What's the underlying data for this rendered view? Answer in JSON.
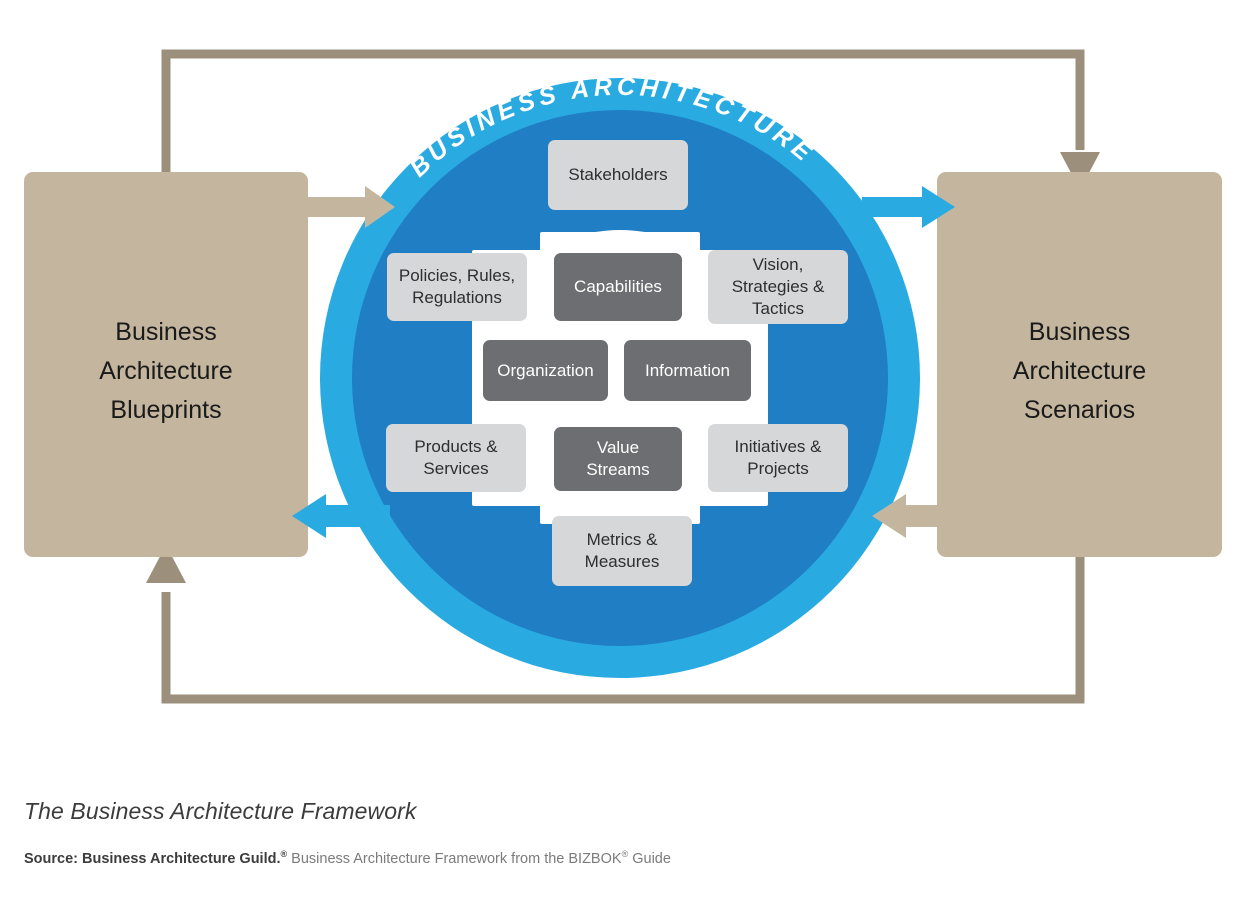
{
  "diagram": {
    "ring_label": "BUSINESS ARCHITECTURE",
    "left_panel": {
      "label": "Business\nArchitecture\nBlueprints"
    },
    "right_panel": {
      "label": "Business\nArchitecture\nScenarios"
    },
    "colors": {
      "ring_outer_blue": "#29abe2",
      "ring_inner_blue": "#1f7ec4",
      "inner_white": "#ffffff",
      "tile_light": "#d6d7d8",
      "tile_dark": "#6d6e71",
      "panel_tan": "#c4b69e",
      "connector_tan": "#9c8f7c",
      "arrow_tan": "#c4b69e",
      "arrow_blue": "#29abe2",
      "page_background": "#ffffff"
    },
    "tiles": [
      {
        "id": "stakeholders",
        "label": "Stakeholders",
        "style": "light"
      },
      {
        "id": "policies",
        "label": "Policies, Rules,\nRegulations",
        "style": "light"
      },
      {
        "id": "capabilities",
        "label": "Capabilities",
        "style": "dark"
      },
      {
        "id": "vision",
        "label": "Vision,\nStrategies &\nTactics",
        "style": "light"
      },
      {
        "id": "organization",
        "label": "Organization",
        "style": "dark"
      },
      {
        "id": "information",
        "label": "Information",
        "style": "dark"
      },
      {
        "id": "products-services",
        "label": "Products &\nServices",
        "style": "light"
      },
      {
        "id": "value-streams",
        "label": "Value\nStreams",
        "style": "dark"
      },
      {
        "id": "initiatives",
        "label": "Initiatives &\nProjects",
        "style": "light"
      },
      {
        "id": "metrics",
        "label": "Metrics &\nMeasures",
        "style": "light"
      }
    ],
    "flows": [
      {
        "id": "blueprints-to-circle",
        "from": "Business Architecture Blueprints",
        "to": "Business Architecture",
        "color": "#c4b69e",
        "direction": "right"
      },
      {
        "id": "circle-to-blueprints",
        "from": "Business Architecture",
        "to": "Business Architecture Blueprints",
        "color": "#29abe2",
        "direction": "left"
      },
      {
        "id": "circle-to-scenarios",
        "from": "Business Architecture",
        "to": "Business Architecture Scenarios",
        "color": "#29abe2",
        "direction": "right"
      },
      {
        "id": "scenarios-to-circle",
        "from": "Business Architecture Scenarios",
        "to": "Business Architecture",
        "color": "#c4b69e",
        "direction": "left"
      },
      {
        "id": "blueprints-to-scenarios-top",
        "from": "Business Architecture Blueprints",
        "to": "Business Architecture Scenarios",
        "color": "#9c8f7c",
        "direction": "down"
      },
      {
        "id": "scenarios-to-blueprints-bottom",
        "from": "Business Architecture Scenarios",
        "to": "Business Architecture Blueprints",
        "color": "#9c8f7c",
        "direction": "up"
      }
    ]
  },
  "caption": {
    "title": "The Business Architecture Framework",
    "source_bold": "Source: Business Architecture Guild.",
    "source_bold_sup": "®",
    "source_rest_a": " Business Architecture Framework from the BIZBOK",
    "source_rest_sup": "®",
    "source_rest_b": " Guide"
  }
}
